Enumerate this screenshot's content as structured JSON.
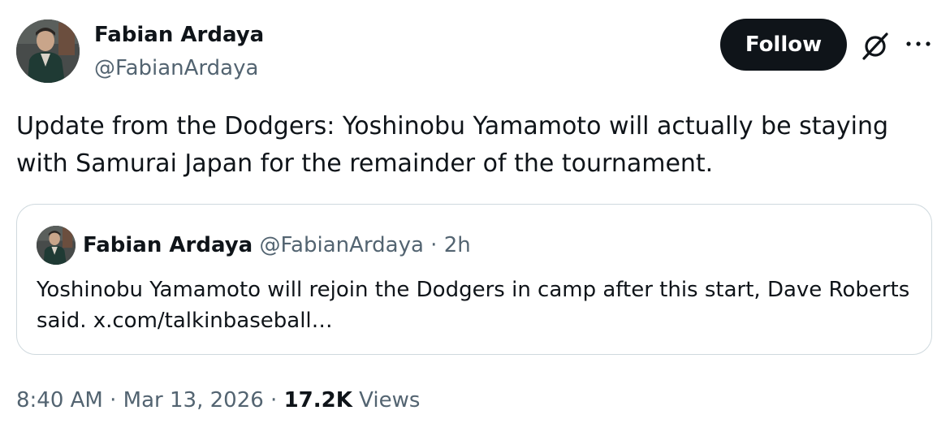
{
  "author": {
    "name": "Fabian Ardaya",
    "handle": "@FabianArdaya"
  },
  "actions": {
    "follow_label": "Follow",
    "grok_icon": "grok-icon",
    "more_icon": "more-icon"
  },
  "tweet": {
    "text": "Update from the Dodgers: Yoshinobu Yamamoto will actually be staying with Samurai Japan for the remainder of the tournament."
  },
  "quote": {
    "author_name": "Fabian Ardaya",
    "author_handle": "@FabianArdaya",
    "separator": "·",
    "time_ago": "2h",
    "text": "Yoshinobu Yamamoto will rejoin the Dodgers in camp after this start, Dave Roberts said. x.com/talkinbaseball…"
  },
  "meta": {
    "time": "8:40 AM",
    "separator": "·",
    "date": "Mar 13, 2026",
    "views_count": "17.2K",
    "views_label": "Views"
  },
  "colors": {
    "text_primary": "#0f1419",
    "text_secondary": "#536471",
    "border": "#cfd9de",
    "follow_bg": "#0f1419",
    "follow_text": "#ffffff"
  }
}
